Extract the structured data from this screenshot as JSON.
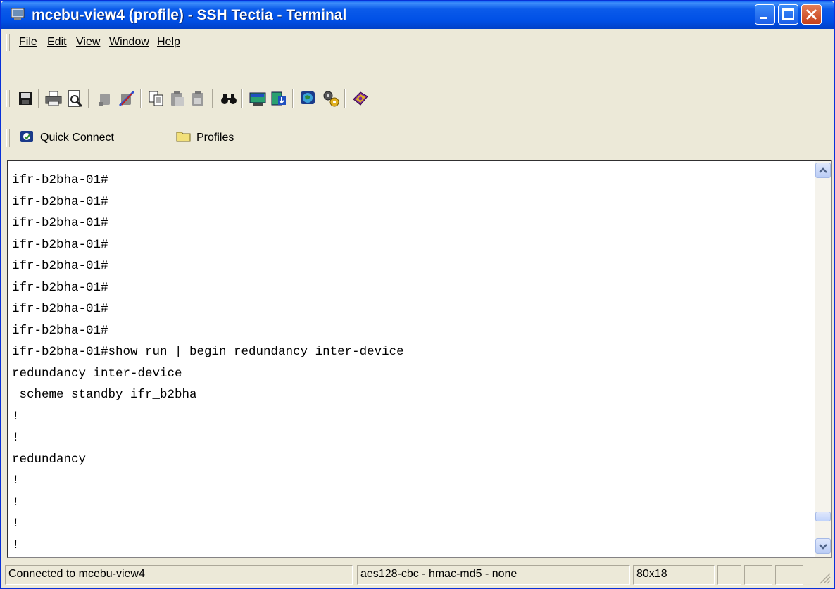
{
  "window": {
    "title": "mcebu-view4 (profile) - SSH Tectia - Terminal",
    "accent": "#0050e6"
  },
  "menu": {
    "items": [
      {
        "label": "File"
      },
      {
        "label": "Edit"
      },
      {
        "label": "View"
      },
      {
        "label": "Window"
      },
      {
        "label": "Help"
      }
    ]
  },
  "toolbar": {
    "icons": [
      "save-icon",
      "print-icon",
      "print-preview-icon",
      "connect-icon",
      "disconnect-icon",
      "copy-icon",
      "paste-icon",
      "paste-alt-icon",
      "find-icon",
      "new-terminal-icon",
      "new-file-transfer-icon",
      "globe-settings-icon",
      "settings-gears-icon",
      "help-book-icon"
    ]
  },
  "quickbar": {
    "quick_connect": "Quick Connect",
    "profiles": "Profiles"
  },
  "terminal": {
    "lines": [
      "ifr-b2bha-01#",
      "ifr-b2bha-01#",
      "ifr-b2bha-01#",
      "ifr-b2bha-01#",
      "ifr-b2bha-01#",
      "ifr-b2bha-01#",
      "ifr-b2bha-01#",
      "ifr-b2bha-01#",
      "ifr-b2bha-01#show run | begin redundancy inter-device",
      "redundancy inter-device",
      " scheme standby ifr_b2bha",
      "!",
      "!",
      "redundancy",
      "!",
      "!",
      "!",
      "!"
    ]
  },
  "status": {
    "connection": "Connected to mcebu-view4",
    "cipher": "aes128-cbc - hmac-md5 - none",
    "size": "80x18"
  }
}
